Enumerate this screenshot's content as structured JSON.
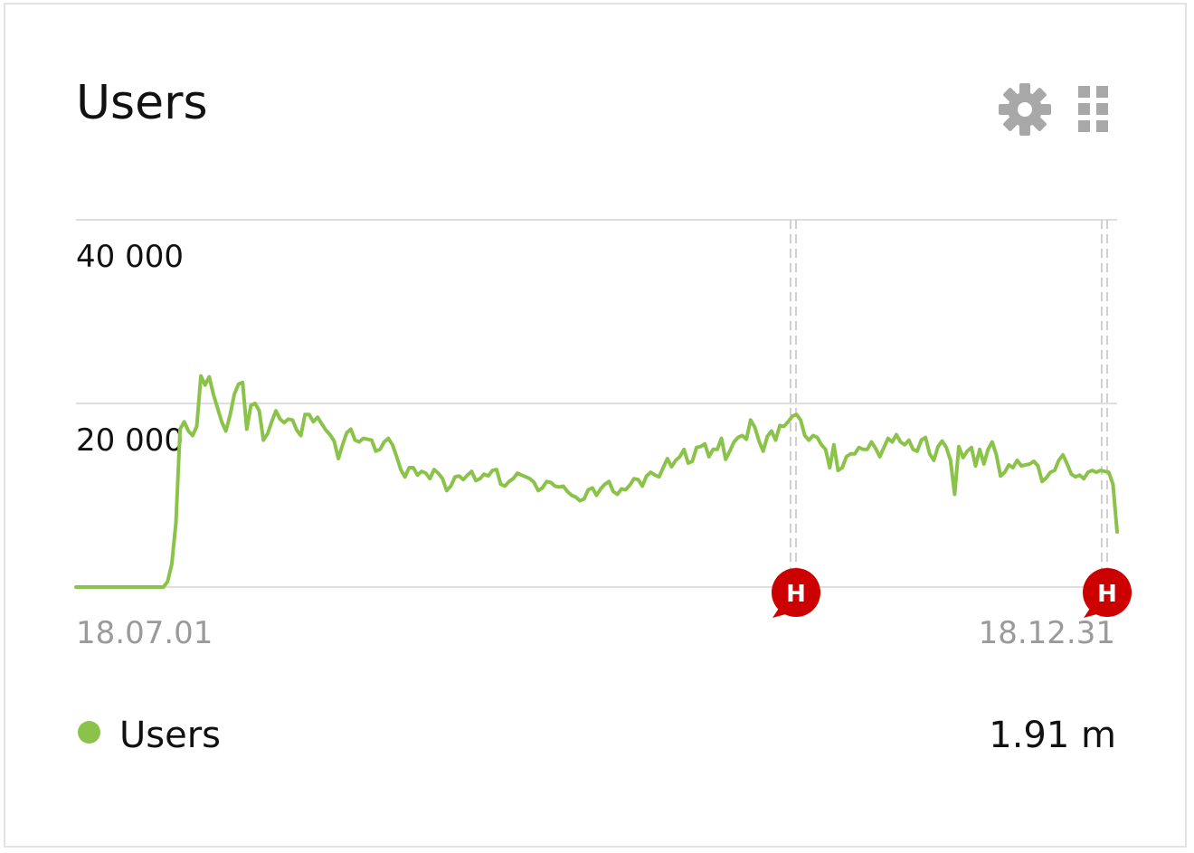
{
  "widget": {
    "title": "Users",
    "settings_icon": "gear-icon",
    "drag_icon": "grid-drag-icon"
  },
  "legend": {
    "series_label": "Users",
    "total": "1.91 m",
    "color": "#8bc34a"
  },
  "annotations": [
    {
      "label": "H",
      "color": "#cc0000"
    },
    {
      "label": "H",
      "color": "#cc0000"
    }
  ],
  "chart_data": {
    "type": "line",
    "x_start": "18.07.01",
    "x_end": "18.12.31",
    "x_tick_labels": [
      "18.07.01",
      "18.12.31"
    ],
    "y_tick_labels": [
      "40 000",
      "20 000"
    ],
    "ylim": [
      0,
      40000
    ],
    "grid": true,
    "series": [
      {
        "name": "Users",
        "color": "#8bc34a",
        "values": [
          0,
          0,
          0,
          0,
          0,
          0,
          0,
          0,
          0,
          0,
          0,
          0,
          0,
          0,
          0,
          0,
          0,
          0,
          0,
          0,
          0,
          0,
          600,
          2500,
          7000,
          17200,
          18000,
          17000,
          16500,
          17500,
          23000,
          22000,
          22900,
          21000,
          19500,
          18000,
          17000,
          18700,
          21000,
          22100,
          22300,
          17200,
          19800,
          20000,
          19200,
          16000,
          16700,
          18000,
          19200,
          18300,
          17900,
          18300,
          18200,
          17100,
          16500,
          18800,
          18800,
          18000,
          18500,
          17800,
          17100,
          16600,
          15900,
          14000,
          15500,
          16800,
          17200,
          16000,
          15800,
          16200,
          16100,
          16000,
          14800,
          15000,
          15800,
          16200,
          15500,
          14200,
          12800,
          12000,
          13000,
          13000,
          12200,
          12600,
          12400,
          11800,
          12800,
          12400,
          11800,
          10500,
          11000,
          12000,
          12100,
          11700,
          12200,
          12600,
          11600,
          11800,
          12300,
          12100,
          12700,
          12800,
          11200,
          11000,
          11500,
          11800,
          12400,
          12200,
          12000,
          11800,
          11400,
          10500,
          10800,
          11500,
          11400,
          11000,
          10900,
          11000,
          10400,
          10000,
          9800,
          9400,
          9600,
          10600,
          10800,
          10000,
          10700,
          11200,
          11500,
          10400,
          10100,
          10700,
          10600,
          11100,
          11800,
          11700,
          11000,
          12100,
          12500,
          12200,
          12000,
          13000,
          14000,
          13100,
          13800,
          14200,
          15000,
          13500,
          13700,
          15200,
          15300,
          15600,
          14200,
          15000,
          15000,
          16200,
          13900,
          14800,
          15800,
          16300,
          16500,
          16100,
          18200,
          17400,
          15900,
          14800,
          16400,
          17000,
          16000,
          17600,
          17500,
          18000,
          18600,
          18800,
          18200,
          16500,
          16000,
          16500,
          16300,
          15500,
          15000,
          13000,
          15500,
          12700,
          13000,
          14200,
          14500,
          14500,
          15200,
          15000,
          15000,
          15800,
          15100,
          14200,
          15200,
          16200,
          15800,
          16600,
          15800,
          15500,
          16000,
          15000,
          14800,
          16000,
          16300,
          14500,
          13800,
          15300,
          15900,
          15200,
          13800,
          10100,
          15300,
          14100,
          14800,
          15200,
          13200,
          15000,
          13400,
          15000,
          15800,
          14400,
          12100,
          12500,
          13300,
          13000,
          13800,
          13200,
          13300,
          13400,
          13700,
          13200,
          11500,
          11900,
          12500,
          12700,
          13800,
          14400,
          13400,
          12300,
          12000,
          12200,
          11800,
          12500,
          12700,
          12500,
          12700,
          12600,
          12500,
          11200,
          6000
        ]
      }
    ]
  }
}
